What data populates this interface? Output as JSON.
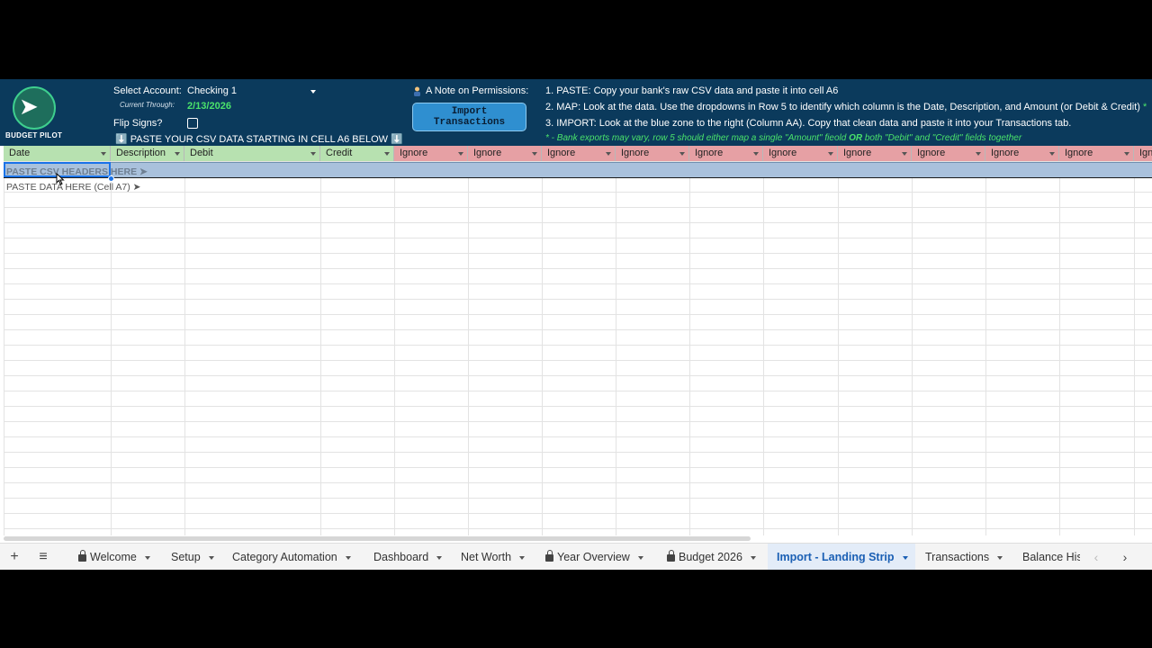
{
  "header": {
    "logo_text": "BUDGET PILOT",
    "select_account_label": "Select Account:",
    "account_value": "Checking 1",
    "current_through_label": "Current Through:",
    "current_through_value": "2/13/2026",
    "flip_signs_label": "Flip Signs?",
    "flip_signs_checked": false,
    "paste_banner": "⬇️ PASTE YOUR CSV DATA STARTING IN CELL A6 BELOW ⬇️",
    "permissions_label": "A Note on Permissions:",
    "import_button": "Import Transactions",
    "instructions": [
      "1. PASTE: Copy your bank's raw CSV data and paste it into cell A6",
      "2. MAP: Look at the data. Use the dropdowns in Row 5 to identify which column is the Date, Description, and Amount (or Debit & Credit)",
      "3. IMPORT: Look at the blue zone to the right (Column AA). Copy that clean data and paste it into your Transactions tab."
    ],
    "instruction_2_asterisk": "*",
    "note_prefix": "* - Bank exports may vary, row 5 should either map a single \"Amount\" fieold ",
    "note_or": "OR",
    "note_suffix": " both \"Debit\" and \"Credit\" fields together"
  },
  "mapping_row": [
    {
      "label": "Date",
      "type": "mapped"
    },
    {
      "label": "Description",
      "type": "mapped"
    },
    {
      "label": "Debit",
      "type": "mapped"
    },
    {
      "label": "Credit",
      "type": "mapped"
    },
    {
      "label": "Ignore",
      "type": "ignore"
    },
    {
      "label": "Ignore",
      "type": "ignore"
    },
    {
      "label": "Ignore",
      "type": "ignore"
    },
    {
      "label": "Ignore",
      "type": "ignore"
    },
    {
      "label": "Ignore",
      "type": "ignore"
    },
    {
      "label": "Ignore",
      "type": "ignore"
    },
    {
      "label": "Ignore",
      "type": "ignore"
    },
    {
      "label": "Ignore",
      "type": "ignore"
    },
    {
      "label": "Ignore",
      "type": "ignore"
    },
    {
      "label": "Ignore",
      "type": "ignore"
    },
    {
      "label": "Ign",
      "type": "ignore"
    }
  ],
  "cells": {
    "a6": "PASTE CSV HEADERS HERE ➤",
    "a7": "PASTE DATA HERE (Cell A7) ➤"
  },
  "toolbar": {
    "add_sheet": "+",
    "all_sheets": "≡"
  },
  "tabs": [
    {
      "label": "Welcome",
      "locked": true,
      "active": false
    },
    {
      "label": "Setup",
      "locked": false,
      "active": false
    },
    {
      "label": "Category Automation",
      "locked": false,
      "active": false
    },
    {
      "label": "Dashboard",
      "locked": false,
      "active": false
    },
    {
      "label": "Net Worth",
      "locked": false,
      "active": false
    },
    {
      "label": "Year Overview",
      "locked": true,
      "active": false
    },
    {
      "label": "Budget 2026",
      "locked": true,
      "active": false
    },
    {
      "label": "Import - Landing Strip",
      "locked": false,
      "active": true
    },
    {
      "label": "Transactions",
      "locked": false,
      "active": false
    },
    {
      "label": "Balance His",
      "locked": false,
      "active": false
    }
  ],
  "nav": {
    "prev": "‹",
    "next": "›"
  },
  "colors": {
    "header_bg": "#0b3a5c",
    "accent_green": "#4ae36b",
    "mapped_bg": "#b7e1b0",
    "ignore_bg": "#e6a0a4",
    "active_tab": "#1a5fb4"
  }
}
